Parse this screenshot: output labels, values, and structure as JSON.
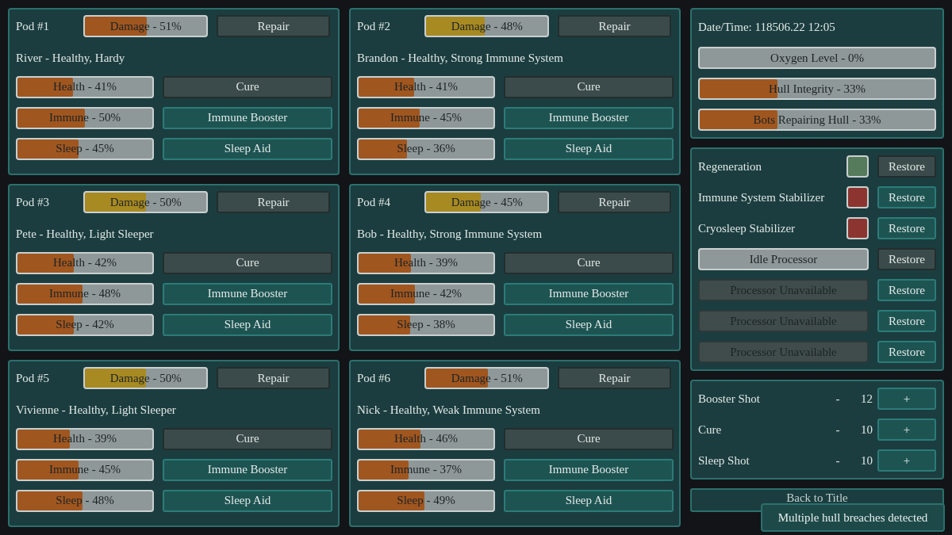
{
  "pods": [
    {
      "title": "Pod #1",
      "damage": {
        "label": "Damage - 51%",
        "level": 0.51,
        "color": "#a0561f"
      },
      "repair": "Repair",
      "crew": "River - Healthy, Hardy",
      "stats": [
        {
          "label": "Health - 41%",
          "level": 0.41,
          "button": {
            "label": "Cure",
            "kind": "muted"
          }
        },
        {
          "label": "Immune - 50%",
          "level": 0.5,
          "button": {
            "label": "Immune Booster",
            "kind": "teal"
          }
        },
        {
          "label": "Sleep - 45%",
          "level": 0.45,
          "button": {
            "label": "Sleep Aid",
            "kind": "teal"
          }
        }
      ]
    },
    {
      "title": "Pod #2",
      "damage": {
        "label": "Damage - 48%",
        "level": 0.48,
        "color": "#a88a22"
      },
      "repair": "Repair",
      "crew": "Brandon - Healthy, Strong Immune System",
      "stats": [
        {
          "label": "Health - 41%",
          "level": 0.41,
          "button": {
            "label": "Cure",
            "kind": "muted"
          }
        },
        {
          "label": "Immune - 45%",
          "level": 0.45,
          "button": {
            "label": "Immune Booster",
            "kind": "teal"
          }
        },
        {
          "label": "Sleep - 36%",
          "level": 0.36,
          "button": {
            "label": "Sleep Aid",
            "kind": "teal"
          }
        }
      ]
    },
    {
      "title": "Pod #3",
      "damage": {
        "label": "Damage - 50%",
        "level": 0.5,
        "color": "#a88a22"
      },
      "repair": "Repair",
      "crew": "Pete - Healthy, Light Sleeper",
      "stats": [
        {
          "label": "Health - 42%",
          "level": 0.42,
          "button": {
            "label": "Cure",
            "kind": "muted"
          }
        },
        {
          "label": "Immune - 48%",
          "level": 0.48,
          "button": {
            "label": "Immune Booster",
            "kind": "teal"
          }
        },
        {
          "label": "Sleep - 42%",
          "level": 0.42,
          "button": {
            "label": "Sleep Aid",
            "kind": "teal"
          }
        }
      ]
    },
    {
      "title": "Pod #4",
      "damage": {
        "label": "Damage - 45%",
        "level": 0.45,
        "color": "#a88a22"
      },
      "repair": "Repair",
      "crew": "Bob - Healthy, Strong Immune System",
      "stats": [
        {
          "label": "Health - 39%",
          "level": 0.39,
          "button": {
            "label": "Cure",
            "kind": "muted"
          }
        },
        {
          "label": "Immune - 42%",
          "level": 0.42,
          "button": {
            "label": "Immune Booster",
            "kind": "teal"
          }
        },
        {
          "label": "Sleep - 38%",
          "level": 0.38,
          "button": {
            "label": "Sleep Aid",
            "kind": "teal"
          }
        }
      ]
    },
    {
      "title": "Pod #5",
      "damage": {
        "label": "Damage - 50%",
        "level": 0.5,
        "color": "#a88a22"
      },
      "repair": "Repair",
      "crew": "Vivienne - Healthy, Light Sleeper",
      "stats": [
        {
          "label": "Health - 39%",
          "level": 0.39,
          "button": {
            "label": "Cure",
            "kind": "muted"
          }
        },
        {
          "label": "Immune - 45%",
          "level": 0.45,
          "button": {
            "label": "Immune Booster",
            "kind": "teal"
          }
        },
        {
          "label": "Sleep - 48%",
          "level": 0.48,
          "button": {
            "label": "Sleep Aid",
            "kind": "teal"
          }
        }
      ]
    },
    {
      "title": "Pod #6",
      "damage": {
        "label": "Damage - 51%",
        "level": 0.51,
        "color": "#a0561f"
      },
      "repair": "Repair",
      "crew": "Nick - Healthy, Weak Immune System",
      "stats": [
        {
          "label": "Health - 46%",
          "level": 0.46,
          "button": {
            "label": "Cure",
            "kind": "muted"
          }
        },
        {
          "label": "Immune - 37%",
          "level": 0.37,
          "button": {
            "label": "Immune Booster",
            "kind": "teal"
          }
        },
        {
          "label": "Sleep - 49%",
          "level": 0.49,
          "button": {
            "label": "Sleep Aid",
            "kind": "teal"
          }
        }
      ]
    }
  ],
  "status": {
    "datetime": "Date/Time: 118506.22 12:05",
    "bars": [
      {
        "label": "Oxygen Level - 0%",
        "level": 0
      },
      {
        "label": "Hull Integrity - 33%",
        "level": 0.33
      },
      {
        "label": "Bots Repairing Hull - 33%",
        "level": 0.33
      }
    ]
  },
  "systems": [
    {
      "kind": "indicator",
      "label": "Regeneration",
      "color": "#567a5c",
      "button": {
        "label": "Restore",
        "kind": "muted"
      }
    },
    {
      "kind": "indicator",
      "label": "Immune System Stabilizer",
      "color": "#8c3530",
      "button": {
        "label": "Restore",
        "kind": "teal"
      }
    },
    {
      "kind": "indicator",
      "label": "Cryosleep Stabilizer",
      "color": "#8c3530",
      "button": {
        "label": "Restore",
        "kind": "teal"
      }
    },
    {
      "kind": "idle",
      "label": "Idle Processor",
      "button": {
        "label": "Restore",
        "kind": "muted"
      }
    },
    {
      "kind": "unavailable",
      "label": "Processor Unavailable",
      "button": {
        "label": "Restore",
        "kind": "teal"
      }
    },
    {
      "kind": "unavailable",
      "label": "Processor Unavailable",
      "button": {
        "label": "Restore",
        "kind": "teal"
      }
    },
    {
      "kind": "unavailable",
      "label": "Processor Unavailable",
      "button": {
        "label": "Restore",
        "kind": "teal"
      }
    }
  ],
  "supplies": [
    {
      "label": "Booster Shot",
      "dash": "-",
      "count": "12",
      "button": "+"
    },
    {
      "label": "Cure",
      "dash": "-",
      "count": "10",
      "button": "+"
    },
    {
      "label": "Sleep Shot",
      "dash": "-",
      "count": "10",
      "button": "+"
    }
  ],
  "back_button": "Back to Title",
  "toast": "Multiple hull breaches detected"
}
